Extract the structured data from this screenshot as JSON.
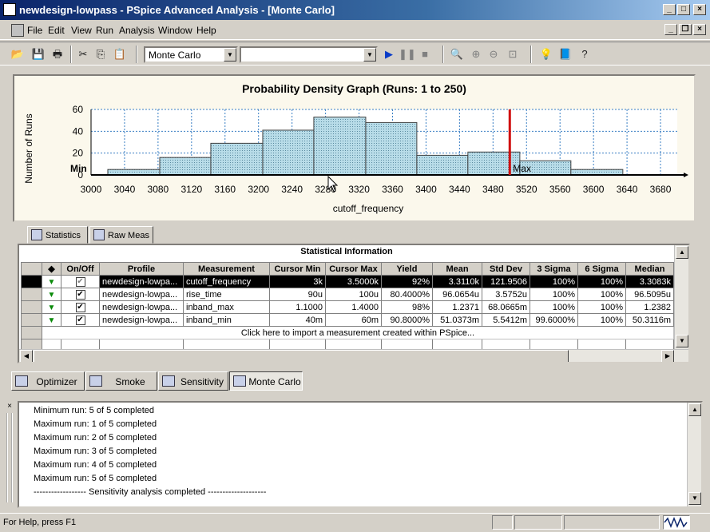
{
  "window": {
    "title": "newdesign-lowpass - PSpice Advanced Analysis - [Monte Carlo]"
  },
  "menu": [
    "File",
    "Edit",
    "View",
    "Run",
    "Analysis",
    "Window",
    "Help"
  ],
  "toolbar": {
    "profile_combo": "Monte Carlo",
    "second_combo": ""
  },
  "graph": {
    "title": "Probability Density Graph (Runs: 1 to 250)",
    "ylabel": "Number of Runs",
    "xlabel": "cutoff_frequency",
    "min_label": "Min",
    "max_label": "Max"
  },
  "chart_data": {
    "type": "bar",
    "title": "Probability Density Graph (Runs: 1 to 250)",
    "xlabel": "cutoff_frequency",
    "ylabel": "Number of Runs",
    "xlim": [
      3000,
      3700
    ],
    "ylim": [
      0,
      60
    ],
    "xticks": [
      "3000",
      "3040",
      "3080",
      "3120",
      "3160",
      "3200",
      "3240",
      "3280",
      "3320",
      "3360",
      "3400",
      "3440",
      "3480",
      "3520",
      "3560",
      "3600",
      "3640",
      "3680"
    ],
    "yticks": [
      "0",
      "20",
      "40",
      "60"
    ],
    "bins": [
      {
        "x0": 3020,
        "x1": 3082,
        "value": 5
      },
      {
        "x0": 3082,
        "x1": 3143,
        "value": 16
      },
      {
        "x0": 3143,
        "x1": 3205,
        "value": 29
      },
      {
        "x0": 3205,
        "x1": 3266,
        "value": 41
      },
      {
        "x0": 3266,
        "x1": 3328,
        "value": 53
      },
      {
        "x0": 3328,
        "x1": 3389,
        "value": 48
      },
      {
        "x0": 3389,
        "x1": 3450,
        "value": 18
      },
      {
        "x0": 3450,
        "x1": 3512,
        "value": 21
      },
      {
        "x0": 3512,
        "x1": 3573,
        "value": 13
      },
      {
        "x0": 3573,
        "x1": 3635,
        "value": 5
      }
    ],
    "max_marker": 3500,
    "grid": true
  },
  "tabs": [
    {
      "label": "Statistics"
    },
    {
      "label": "Raw Meas"
    }
  ],
  "grid": {
    "caption": "Statistical Information",
    "columns": [
      "◆",
      "On/Off",
      "Profile",
      "Measurement",
      "Cursor Min",
      "Cursor Max",
      "Yield",
      "Mean",
      "Std Dev",
      "3 Sigma",
      "6 Sigma",
      "Median"
    ],
    "rows": [
      [
        "newdesign-lowpa...",
        "cutoff_frequency",
        "3k",
        "3.5000k",
        "92%",
        "3.3110k",
        "121.9506",
        "100%",
        "100%",
        "3.3083k"
      ],
      [
        "newdesign-lowpa...",
        "rise_time",
        "90u",
        "100u",
        "80.4000%",
        "96.0654u",
        "3.5752u",
        "100%",
        "100%",
        "96.5095u"
      ],
      [
        "newdesign-lowpa...",
        "inband_max",
        "1.1000",
        "1.4000",
        "98%",
        "1.2371",
        "68.0665m",
        "100%",
        "100%",
        "1.2382"
      ],
      [
        "newdesign-lowpa...",
        "inband_min",
        "40m",
        "60m",
        "90.8000%",
        "51.0373m",
        "5.5412m",
        "99.6000%",
        "100%",
        "50.3116m"
      ]
    ],
    "import_text": "Click here to import a measurement created within PSpice..."
  },
  "bottom_tabs": [
    "Optimizer",
    "Smoke",
    "Sensitivity",
    "Monte Carlo"
  ],
  "output": [
    "Minimum run: 5 of 5 completed",
    "Maximum run: 1 of 5 completed",
    "Maximum run: 2 of 5 completed",
    "Maximum run: 3 of 5 completed",
    "Maximum run: 4 of 5 completed",
    "Maximum run: 5 of 5 completed",
    "------------------ Sensitivity analysis completed --------------------"
  ],
  "status": {
    "message": "For Help, press F1"
  }
}
